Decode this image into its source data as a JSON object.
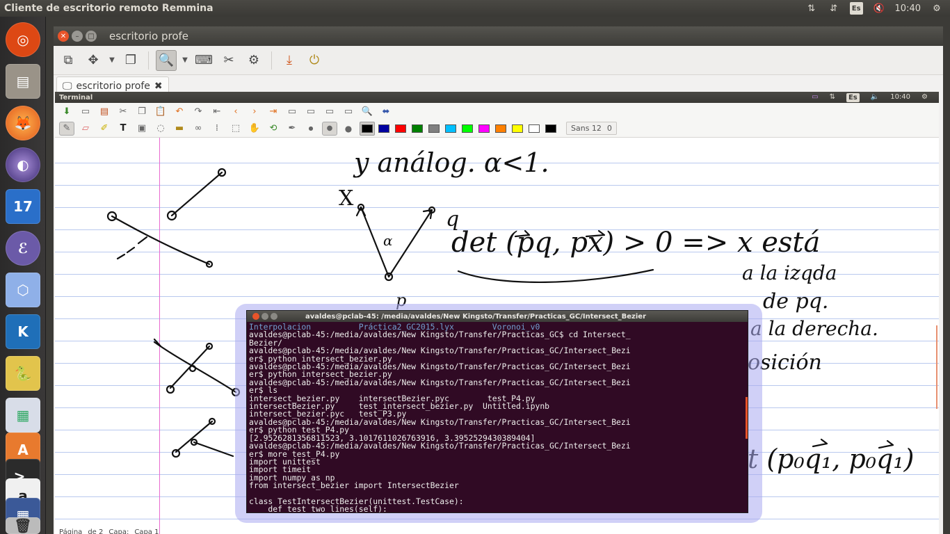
{
  "top_panel": {
    "app_title": "Cliente de escritorio remoto Remmina",
    "keyboard": "Es",
    "time": "10:40"
  },
  "launcher": {
    "items": [
      "ubuntu-dash",
      "files",
      "firefox",
      "eclipse",
      "texmaker-17",
      "emacs",
      "geogebra",
      "kile",
      "python",
      "libreoffice",
      "software-center",
      "terminal",
      "amazon",
      "workspace-switcher",
      "trash"
    ]
  },
  "window": {
    "title": "escritorio profe",
    "tab_label": "escritorio profe"
  },
  "remote": {
    "panel_title": "Terminal",
    "keyboard": "Es",
    "time": "10:40",
    "font_box": {
      "font": "Sans 12",
      "value": "0"
    },
    "status": {
      "page_label": "Página",
      "page_of": "de 2",
      "layer_label": "Capa:",
      "layer_value": "Capa 1"
    }
  },
  "terminal": {
    "title": "avaldes@pclab-45: /media/avaldes/New Kingsto/Transfer/Practicas_GC/Intersect_Bezier",
    "lines": [
      {
        "text": "Interpolacion          Práctica2_GC2015.lyx        Voronoi_v0",
        "dir": true
      },
      {
        "text": "avaldes@pclab-45:/media/avaldes/New Kingsto/Transfer/Practicas_GC$ cd Intersect_"
      },
      {
        "text": "Bezier/"
      },
      {
        "text": "avaldes@pclab-45:/media/avaldes/New Kingsto/Transfer/Practicas_GC/Intersect_Bezi"
      },
      {
        "text": "er$ python intersect_bezier.py"
      },
      {
        "text": "avaldes@pclab-45:/media/avaldes/New Kingsto/Transfer/Practicas_GC/Intersect_Bezi"
      },
      {
        "text": "er$ python intersect_bezier.py"
      },
      {
        "text": "avaldes@pclab-45:/media/avaldes/New Kingsto/Transfer/Practicas_GC/Intersect_Bezi"
      },
      {
        "text": "er$ ls"
      },
      {
        "text": "intersect_bezier.py    intersectBezier.pyc        test_P4.py"
      },
      {
        "text": "intersectBezier.py     test_intersect_bezier.py  Untitled.ipynb"
      },
      {
        "text": "intersect_bezier.pyc   test_P3.py"
      },
      {
        "text": "avaldes@pclab-45:/media/avaldes/New Kingsto/Transfer/Practicas_GC/Intersect_Bezi"
      },
      {
        "text": "er$ python test_P4.py"
      },
      {
        "text": "[2.9526281356811523, 3.1017611026763916, 3.3952529430389404]"
      },
      {
        "text": "avaldes@pclab-45:/media/avaldes/New Kingsto/Transfer/Practicas_GC/Intersect_Bezi"
      },
      {
        "text": "er$ more test_P4.py"
      },
      {
        "text": "import unittest"
      },
      {
        "text": "import timeit"
      },
      {
        "text": "import numpy as np"
      },
      {
        "text": "from intersect_bezier import IntersectBezier"
      },
      {
        "text": ""
      },
      {
        "text": "class TestIntersectBezier(unittest.TestCase):"
      },
      {
        "text": "    def test_two_lines(self):"
      }
    ]
  },
  "handwriting": {
    "line1": "y análog. α<1.",
    "label_x": "X",
    "label_q": "q",
    "label_alpha": "α",
    "label_p": "p",
    "det": "det (pq, px) > 0 => x está",
    "izq1": "a la izqda",
    "izq2": "de pq.",
    "der": "a la derecha.",
    "posicion": "osición",
    "det2": "t (p₀q₁, p₀q₁)"
  },
  "colors": {
    "palette": [
      "#000000",
      "#0000a0",
      "#ff0000",
      "#008000",
      "#808080",
      "#00c0ff",
      "#00ff00",
      "#ff00ff",
      "#ff8000",
      "#ffff00",
      "#ffffff",
      "#000000"
    ]
  }
}
